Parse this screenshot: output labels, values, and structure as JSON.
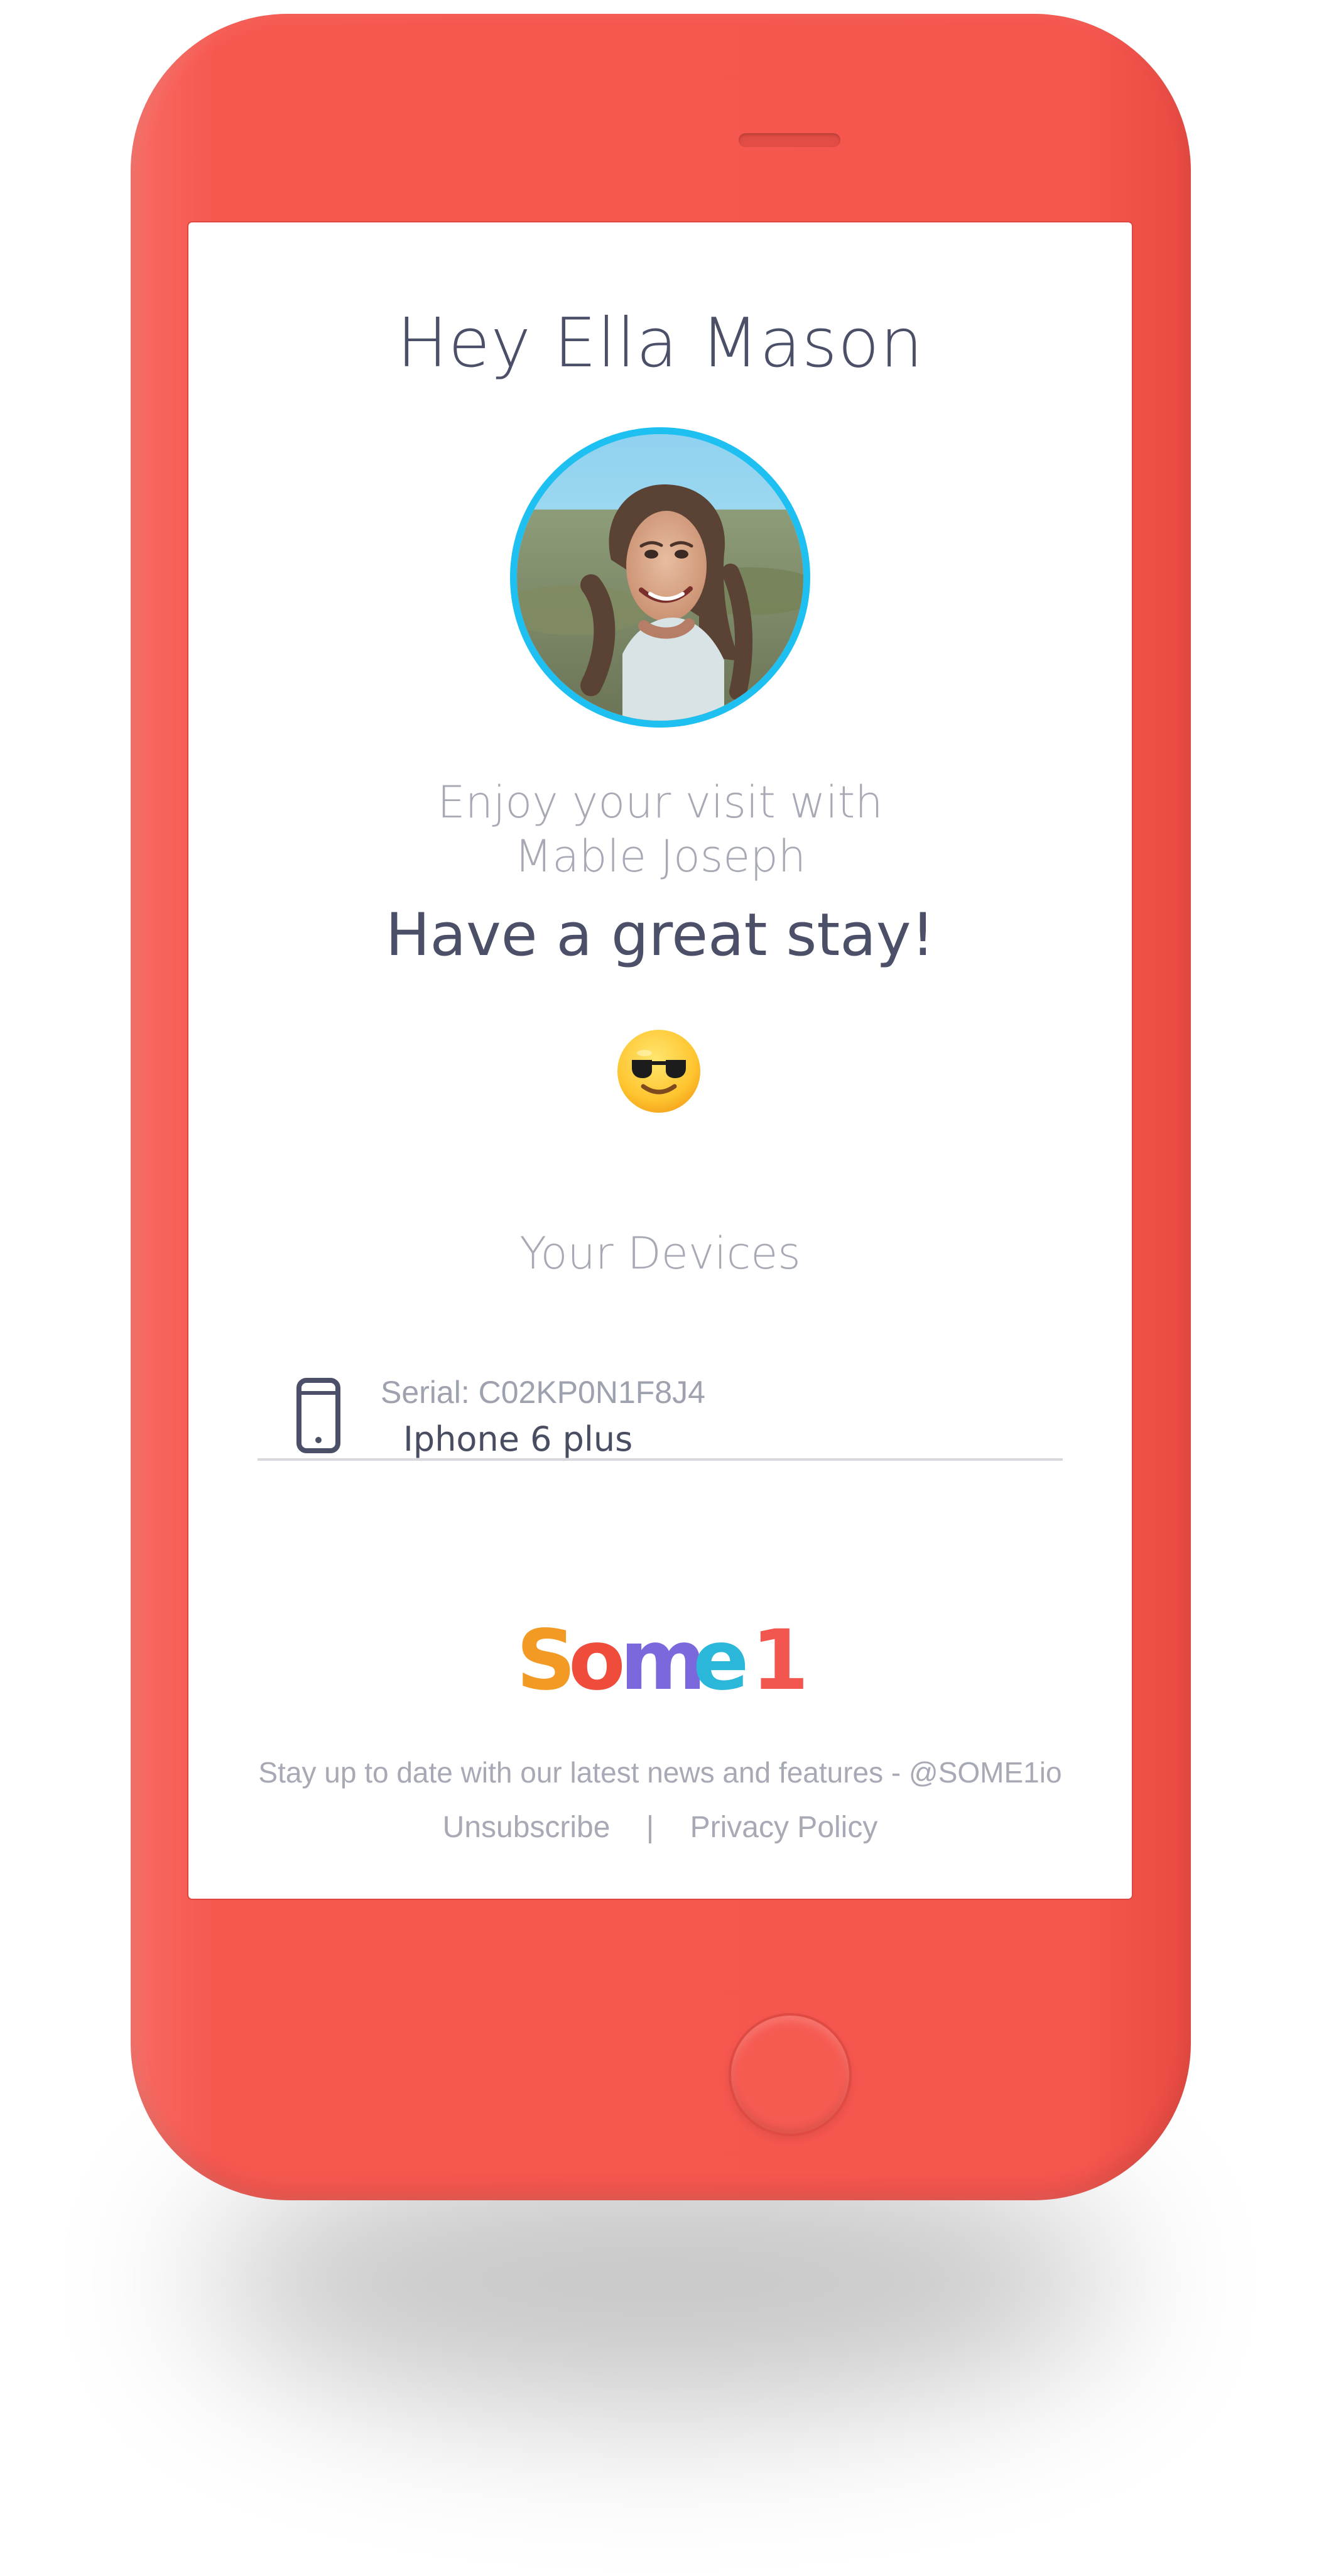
{
  "header": {
    "greeting": "Hey Ella Mason"
  },
  "visit": {
    "line1": "Enjoy your visit with",
    "line2": "Mable Joseph",
    "tagline": "Have a great stay!"
  },
  "devices": {
    "heading": "Your Devices",
    "items": [
      {
        "serial": "Serial: C02KP0N1F8J4",
        "name": "Iphone 6 plus"
      }
    ]
  },
  "footer": {
    "brand": "Some1",
    "message": "Stay up to date with our latest news and features - @SOME1io",
    "unsubscribe": "Unsubscribe",
    "separator": "|",
    "privacy": "Privacy Policy"
  },
  "colors": {
    "phone_body": "#f5564e",
    "avatar_ring": "#1ec0f2",
    "heading_text": "#4b5068",
    "muted_text": "#a7a9b4"
  },
  "icons": {
    "emoji": "smiling-face-with-sunglasses-icon",
    "device": "smartphone-icon"
  }
}
